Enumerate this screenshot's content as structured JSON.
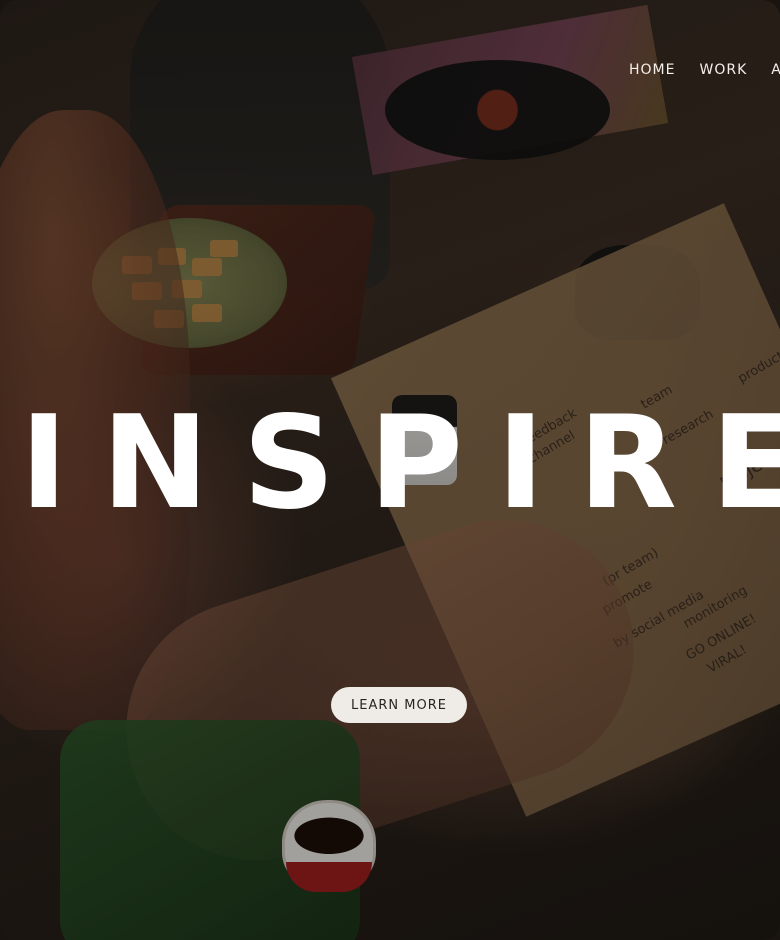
{
  "nav": {
    "items": [
      {
        "label": "HOME"
      },
      {
        "label": "WORK"
      },
      {
        "label": "AB"
      }
    ]
  },
  "hero": {
    "title": "INSPIRE",
    "cta_label": "LEARN MORE"
  },
  "background": {
    "scribbles": [
      "feedback",
      "team",
      "research",
      "(pr team)",
      "promote",
      "by social media",
      "monitoring",
      "GO ONLINE!",
      "VIRAL!",
      "Project",
      "product",
      "channel"
    ]
  },
  "colors": {
    "title": "#ffffff",
    "cta_bg": "#efebe6",
    "cta_text": "#2a2420",
    "nav_text": "#f4efe8"
  }
}
